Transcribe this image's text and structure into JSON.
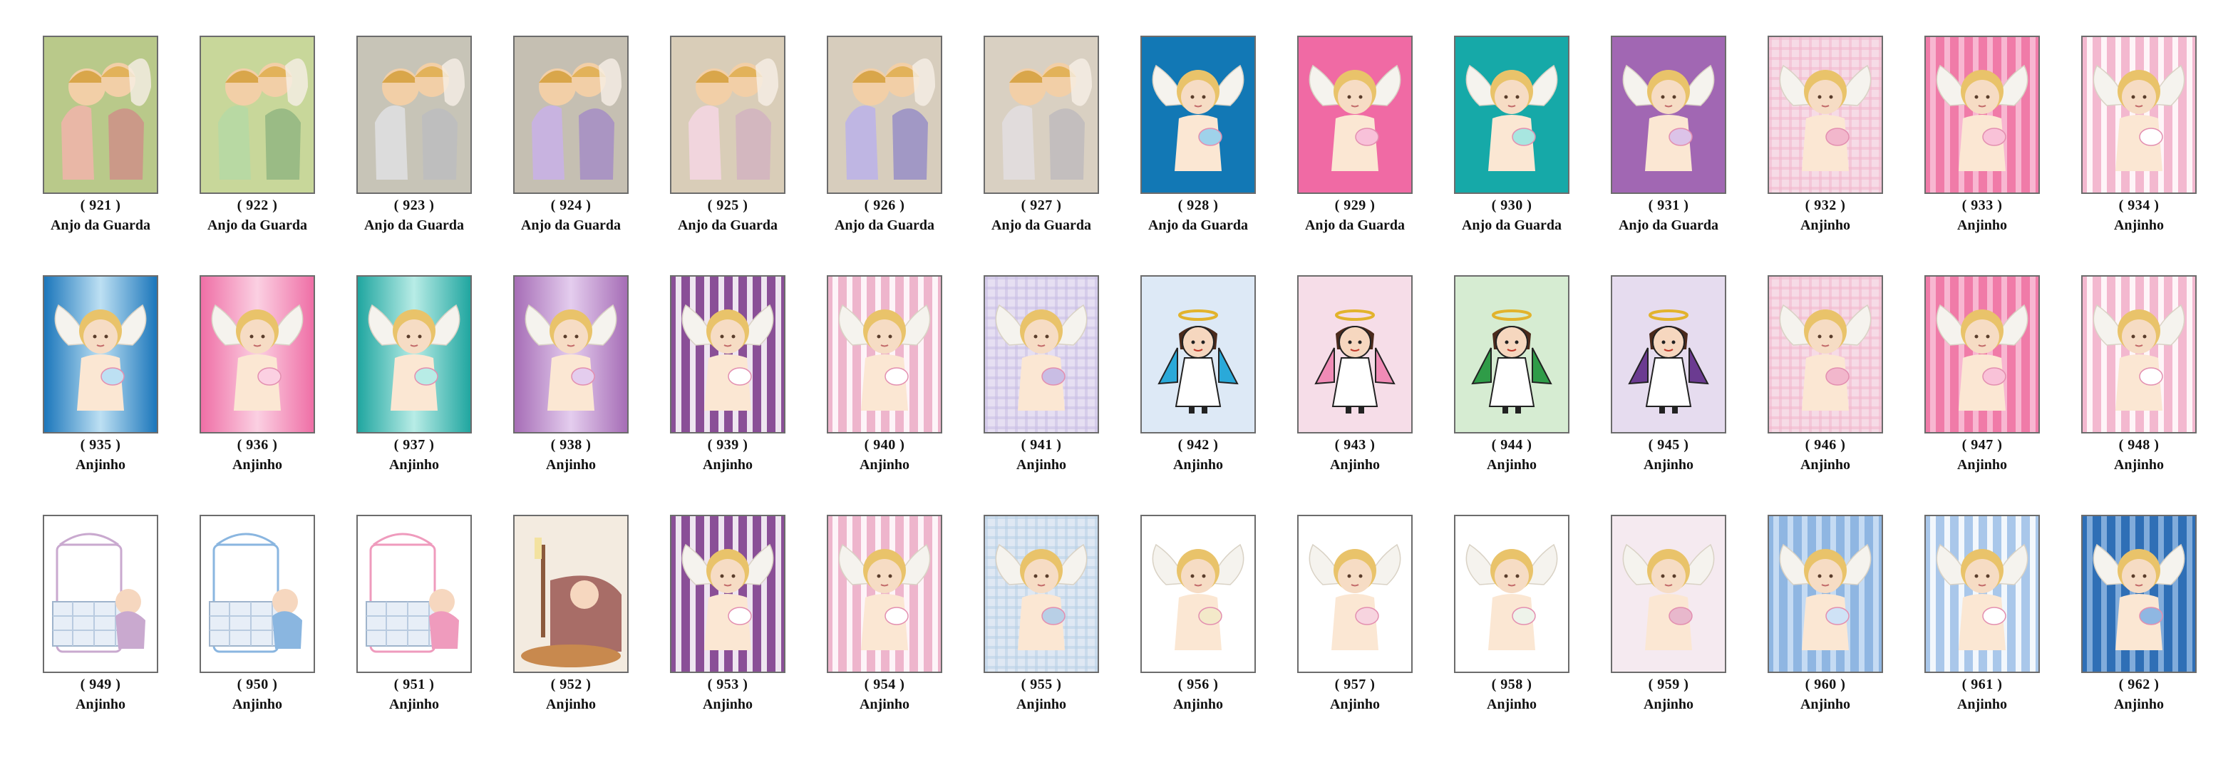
{
  "items": [
    {
      "number": "( 921 )",
      "name": "Anjo da Guarda",
      "bg": "#b9c98a",
      "style": "painting",
      "accent": "#e9b7a6"
    },
    {
      "number": "( 922 )",
      "name": "Anjo da Guarda",
      "bg": "#c8d79a",
      "style": "painting",
      "accent": "#b8d9a3"
    },
    {
      "number": "( 923 )",
      "name": "Anjo da Guarda",
      "bg": "#c7c4b7",
      "style": "painting",
      "accent": "#dcdcdc"
    },
    {
      "number": "( 924 )",
      "name": "Anjo da Guarda",
      "bg": "#c5bfb2",
      "style": "painting",
      "accent": "#c8b3e0"
    },
    {
      "number": "( 925 )",
      "name": "Anjo da Guarda",
      "bg": "#d9cdb8",
      "style": "painting",
      "accent": "#f1d5dd"
    },
    {
      "number": "( 926 )",
      "name": "Anjo da Guarda",
      "bg": "#d7cdbd",
      "style": "painting",
      "accent": "#bfb6e3"
    },
    {
      "number": "( 927 )",
      "name": "Anjo da Guarda",
      "bg": "#d9d0c2",
      "style": "painting",
      "accent": "#e1dcdc"
    },
    {
      "number": "( 928 )",
      "name": "Anjo da Guarda",
      "bg": "#1278b5",
      "style": "solid",
      "accent": "#9fd2ea"
    },
    {
      "number": "( 929 )",
      "name": "Anjo da Guarda",
      "bg": "#f06aa4",
      "style": "solid",
      "accent": "#f8c1d9"
    },
    {
      "number": "( 930 )",
      "name": "Anjo da Guarda",
      "bg": "#16a9a8",
      "style": "solid",
      "accent": "#a8e6e0"
    },
    {
      "number": "( 931 )",
      "name": "Anjo da Guarda",
      "bg": "#a167b3",
      "style": "solid",
      "accent": "#dcc3e8"
    },
    {
      "number": "( 932 )",
      "name": "Anjinho",
      "bg": "#f6dbe6",
      "style": "plaid",
      "accent": "#f2b7cc"
    },
    {
      "number": "( 933 )",
      "name": "Anjinho",
      "bg": "#f07ba8",
      "style": "stripes",
      "accent": "#f9c2d8"
    },
    {
      "number": "( 934 )",
      "name": "Anjinho",
      "bg": "#f3b8cf",
      "style": "stripes",
      "accent": "#ffffff"
    },
    {
      "number": "( 935 )",
      "name": "Anjinho",
      "bg": "#1b76bb",
      "style": "gradient",
      "accent": "#bde0f3"
    },
    {
      "number": "( 936 )",
      "name": "Anjinho",
      "bg": "#ef6fa6",
      "style": "gradient",
      "accent": "#fbd0e2"
    },
    {
      "number": "( 937 )",
      "name": "Anjinho",
      "bg": "#20a6a0",
      "style": "gradient",
      "accent": "#b8ece6"
    },
    {
      "number": "( 938 )",
      "name": "Anjinho",
      "bg": "#a66db6",
      "style": "gradient",
      "accent": "#e4cdee"
    },
    {
      "number": "( 939 )",
      "name": "Anjinho",
      "bg": "#8a4f97",
      "style": "stripes",
      "accent": "#ffffff"
    },
    {
      "number": "(  940  )",
      "name": "Anjinho",
      "bg": "#eeb5cc",
      "style": "stripes",
      "accent": "#ffffff"
    },
    {
      "number": "( 941 )",
      "name": "Anjinho",
      "bg": "#e6dff2",
      "style": "plaid",
      "accent": "#c9bde4"
    },
    {
      "number": "( 942 )",
      "name": "Anjinho",
      "bg": "#dde9f6",
      "style": "cartoon",
      "accent": "#2aa9d9"
    },
    {
      "number": "( 943 )",
      "name": "Anjinho",
      "bg": "#f6dde8",
      "style": "cartoon",
      "accent": "#f08bb6"
    },
    {
      "number": "( 944 )",
      "name": "Anjinho",
      "bg": "#d6ecd2",
      "style": "cartoon",
      "accent": "#2f9c48"
    },
    {
      "number": "( 945 )",
      "name": "Anjinho",
      "bg": "#e6dcef",
      "style": "cartoon",
      "accent": "#6b3b91"
    },
    {
      "number": "( 946 )",
      "name": "Anjinho",
      "bg": "#f6dbe6",
      "style": "plaid",
      "accent": "#f2b7cc"
    },
    {
      "number": "( 947 )",
      "name": "Anjinho",
      "bg": "#f07ba8",
      "style": "stripes",
      "accent": "#f9c2d8"
    },
    {
      "number": "( 948 )",
      "name": "Anjinho",
      "bg": "#f3b8cf",
      "style": "stripes",
      "accent": "#ffffff"
    },
    {
      "number": "( 949 )",
      "name": "Anjinho",
      "bg": "#ffffff",
      "style": "crib",
      "accent": "#c9a9cf"
    },
    {
      "number": "( 950 )",
      "name": "Anjinho",
      "bg": "#ffffff",
      "style": "crib",
      "accent": "#8ab6e0"
    },
    {
      "number": "( 951 )",
      "name": "Anjinho",
      "bg": "#ffffff",
      "style": "crib",
      "accent": "#ef9bbd"
    },
    {
      "number": "( 952 )",
      "name": "Anjinho",
      "bg": "#f4eee5",
      "style": "bedtime",
      "accent": "#8b5a3c"
    },
    {
      "number": "( 953 )",
      "name": "Anjinho",
      "bg": "#8a4f97",
      "style": "stripes",
      "accent": "#ffffff"
    },
    {
      "number": "( 954 )",
      "name": "Anjinho",
      "bg": "#eeb5cc",
      "style": "stripes",
      "accent": "#ffffff"
    },
    {
      "number": "( 955 )",
      "name": "Anjinho",
      "bg": "#dfe8f3",
      "style": "plaid",
      "accent": "#b8cfe6"
    },
    {
      "number": "( 956 )",
      "name": "Anjinho",
      "bg": "#ffffff",
      "style": "plain",
      "accent": "#f3e9c9"
    },
    {
      "number": "( 957 )",
      "name": "Anjinho",
      "bg": "#ffffff",
      "style": "plain",
      "accent": "#f7d4df"
    },
    {
      "number": "( 958 )",
      "name": "Anjinho",
      "bg": "#ffffff",
      "style": "plain",
      "accent": "#eef3ea"
    },
    {
      "number": "( 959 )",
      "name": "Anjinho",
      "bg": "#f5eaf0",
      "style": "floral",
      "accent": "#e8b8cc"
    },
    {
      "number": "( 960 )",
      "name": "Anjinho",
      "bg": "#8fb6e2",
      "style": "stripes",
      "accent": "#cfe2f6"
    },
    {
      "number": "( 961 )",
      "name": "Anjinho",
      "bg": "#a9c7ea",
      "style": "stripes",
      "accent": "#ffffff"
    },
    {
      "number": "( 962 )",
      "name": "Anjinho",
      "bg": "#2f6fb6",
      "style": "stripes",
      "accent": "#8fb7e2"
    }
  ]
}
